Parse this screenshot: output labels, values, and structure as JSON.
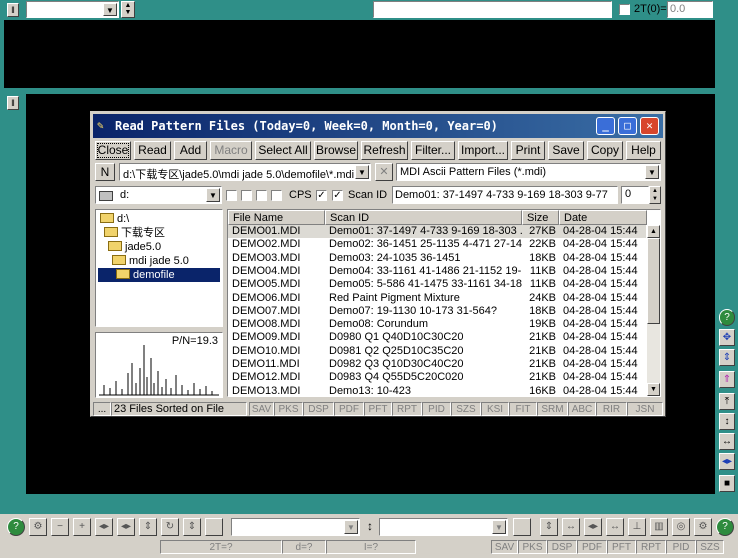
{
  "top_bar": {
    "combo_value": "",
    "field_value": "",
    "checkbox_label": "2T(0)=",
    "checkbox_value": "0.0"
  },
  "dialog": {
    "title": "Read Pattern Files (Today=0, Week=0, Month=0, Year=0)",
    "toolbar": [
      "Close",
      "Read",
      "Add",
      "Macro",
      "Select All",
      "Browse",
      "Refresh",
      "Filter...",
      "Import...",
      "Print",
      "Save",
      "Copy",
      "Help"
    ],
    "path_button": "N",
    "path_value": "d:\\下载专区\\jade5.0\\mdi jade 5.0\\demofile\\*.mdi",
    "filter_value": "MDI Ascii Pattern Files (*.mdi)",
    "drive_value": "d:",
    "cps_label": "CPS",
    "scan_id_label": "Scan ID",
    "scan_id_value": "Demo01: 37-1497 4-733 9-169 18-303 9-77",
    "spin_value": "0",
    "tree": [
      {
        "label": "d:\\",
        "level": 0
      },
      {
        "label": "下载专区",
        "level": 1
      },
      {
        "label": "jade5.0",
        "level": 2
      },
      {
        "label": "mdi jade 5.0",
        "level": 3
      },
      {
        "label": "demofile",
        "level": 4,
        "selected": true
      }
    ],
    "preview_label": "P/N=19.3",
    "columns": [
      "File Name",
      "Scan ID",
      "Size",
      "Date"
    ],
    "files": [
      {
        "name": "DEMO01.MDI",
        "scan": "Demo01: 37-1497 4-733 9-169 18-303 ...",
        "size": "27KB",
        "date": "04-28-04 15:44",
        "selected": true
      },
      {
        "name": "DEMO02.MDI",
        "scan": "Demo02: 36-1451 25-1135 4-471 27-14...",
        "size": "22KB",
        "date": "04-28-04 15:44"
      },
      {
        "name": "DEMO03.MDI",
        "scan": "Demo03: 24-1035 36-1451",
        "size": "18KB",
        "date": "04-28-04 15:44"
      },
      {
        "name": "DEMO04.MDI",
        "scan": "Demo04: 33-1161 41-1486 21-1152 19-...",
        "size": "11KB",
        "date": "04-28-04 15:44"
      },
      {
        "name": "DEMO05.MDI",
        "scan": "Demo05: 5-586 41-1475 33-1161 34-18...",
        "size": "11KB",
        "date": "04-28-04 15:44"
      },
      {
        "name": "DEMO06.MDI",
        "scan": "Red Paint Pigment Mixture",
        "size": "24KB",
        "date": "04-28-04 15:44"
      },
      {
        "name": "DEMO07.MDI",
        "scan": "Demo07: 19-1130 10-173 31-564?",
        "size": "18KB",
        "date": "04-28-04 15:44"
      },
      {
        "name": "DEMO08.MDI",
        "scan": "Demo08: Corundum",
        "size": "19KB",
        "date": "04-28-04 15:44"
      },
      {
        "name": "DEMO09.MDI",
        "scan": "D0980 Q1 Q40D10C30C20",
        "size": "21KB",
        "date": "04-28-04 15:44"
      },
      {
        "name": "DEMO10.MDI",
        "scan": "D0981 Q2 Q25D10C35C20",
        "size": "21KB",
        "date": "04-28-04 15:44"
      },
      {
        "name": "DEMO11.MDI",
        "scan": "D0982 Q3 Q10D30C40C20",
        "size": "21KB",
        "date": "04-28-04 15:44"
      },
      {
        "name": "DEMO12.MDI",
        "scan": "D0983 Q4 Q55D5C20C020",
        "size": "21KB",
        "date": "04-28-04 15:44"
      },
      {
        "name": "DEMO13.MDI",
        "scan": "Demo13: 10-423",
        "size": "16KB",
        "date": "04-28-04 15:44"
      }
    ],
    "status_left": "...",
    "status_text": "23 Files Sorted on File Name",
    "status_tags": [
      "SAV",
      "PKS",
      "DSP",
      "PDF",
      "PFT",
      "RPT",
      "PID",
      "SZS",
      "KSI",
      "FIT",
      "SRM",
      "ABC",
      "RIR",
      "JSN"
    ]
  },
  "bottom": {
    "combo1": "",
    "combo2": "",
    "readouts": [
      "2T=?",
      "d=?",
      "I=?"
    ],
    "status_tags": [
      "SAV",
      "PKS",
      "DSP",
      "PDF",
      "PFT",
      "RPT",
      "PID",
      "SZS"
    ]
  },
  "colors": {
    "teal": "#2f8f88",
    "title_start": "#0a246a",
    "title_end": "#3a6ea5",
    "selection": "#0a246a"
  }
}
